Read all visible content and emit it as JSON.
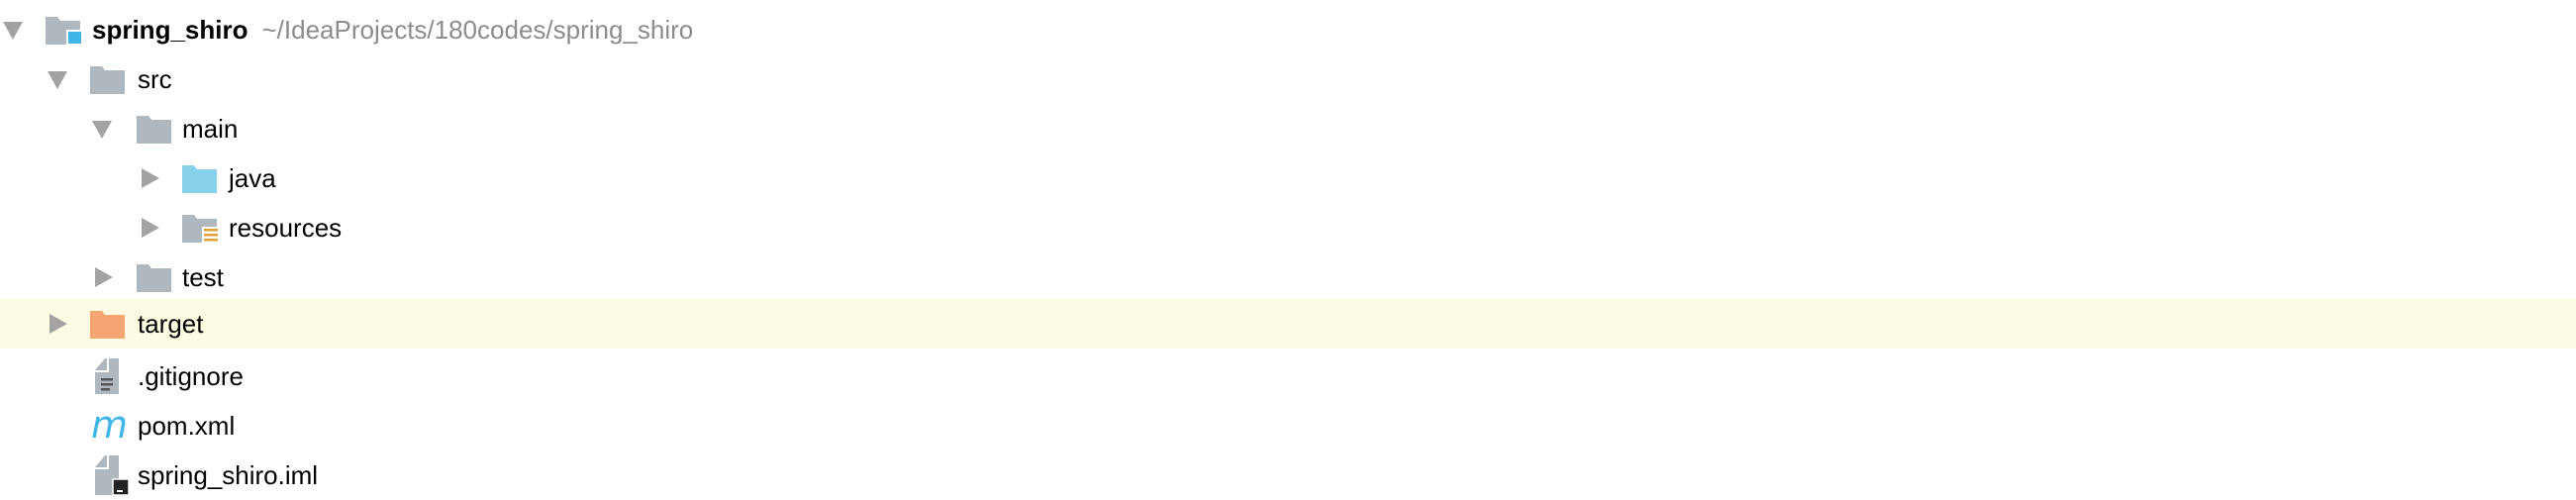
{
  "tree": {
    "root": {
      "label": "spring_shiro",
      "path": "~/IdeaProjects/180codes/spring_shiro",
      "expanded": true
    },
    "src": {
      "label": "src",
      "expanded": true
    },
    "main": {
      "label": "main",
      "expanded": true
    },
    "java": {
      "label": "java",
      "expanded": false
    },
    "resources": {
      "label": "resources",
      "expanded": false
    },
    "test": {
      "label": "test",
      "expanded": false
    },
    "target": {
      "label": "target",
      "expanded": false,
      "highlighted": true
    },
    "gitignore": {
      "label": ".gitignore"
    },
    "pom": {
      "label": "pom.xml",
      "icon_text": "m"
    },
    "iml": {
      "label": "spring_shiro.iml"
    }
  },
  "colors": {
    "folder": "#afb8bf",
    "source_folder": "#87d1ea",
    "excluded_folder": "#f5a572",
    "module_badge": "#3fb6e6",
    "resources_badge": "#e0a23a",
    "highlight": "#fefde3"
  }
}
